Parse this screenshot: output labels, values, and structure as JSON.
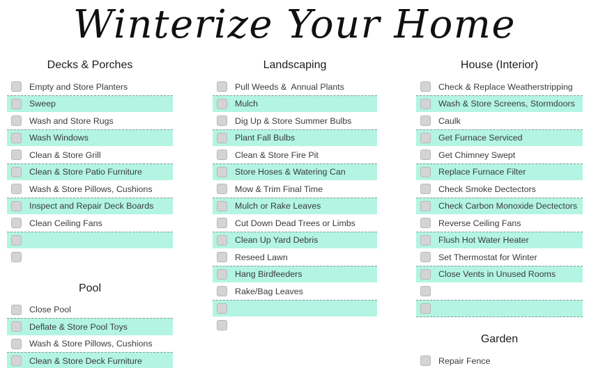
{
  "page": {
    "title": "Winterize Your Home",
    "background_color": "#ffffff",
    "shaded_row_color": "#b3f5e2",
    "checkbox_color": "#d4d4d4",
    "text_color": "#3a3a3a"
  },
  "columns": [
    {
      "id": "column-left",
      "sections": [
        {
          "name": "decks-and-porches",
          "header": "Decks & Porches",
          "items": [
            {
              "label": "Empty and Store Planters",
              "shaded": false
            },
            {
              "label": "Sweep",
              "shaded": true
            },
            {
              "label": "Wash and Store Rugs",
              "shaded": false
            },
            {
              "label": "Wash Windows",
              "shaded": true
            },
            {
              "label": "Clean & Store Grill",
              "shaded": false
            },
            {
              "label": "Clean & Store Patio Furniture",
              "shaded": true
            },
            {
              "label": "Wash & Store Pillows, Cushions",
              "shaded": false
            },
            {
              "label": "Inspect and Repair Deck Boards",
              "shaded": true
            },
            {
              "label": "Clean Ceiling Fans",
              "shaded": false
            },
            {
              "label": "",
              "shaded": true
            },
            {
              "label": "",
              "shaded": false
            }
          ]
        },
        {
          "name": "pool",
          "header": "Pool",
          "items": [
            {
              "label": "Close Pool",
              "shaded": false
            },
            {
              "label": "Deflate & Store Pool Toys",
              "shaded": true
            },
            {
              "label": "Wash & Store Pillows, Cushions",
              "shaded": false
            },
            {
              "label": "Clean & Store Deck Furniture",
              "shaded": true
            }
          ]
        }
      ]
    },
    {
      "id": "column-center",
      "sections": [
        {
          "name": "landscaping",
          "header": "Landscaping",
          "items": [
            {
              "label": "Pull Weeds &  Annual Plants",
              "shaded": false
            },
            {
              "label": "Mulch",
              "shaded": true
            },
            {
              "label": "Dig Up & Store Summer Bulbs",
              "shaded": false
            },
            {
              "label": "Plant Fall Bulbs",
              "shaded": true
            },
            {
              "label": "Clean & Store Fire Pit",
              "shaded": false
            },
            {
              "label": "Store Hoses & Watering Can",
              "shaded": true
            },
            {
              "label": "Mow & Trim Final Time",
              "shaded": false
            },
            {
              "label": "Mulch or Rake Leaves",
              "shaded": true
            },
            {
              "label": "Cut Down Dead Trees or Limbs",
              "shaded": false
            },
            {
              "label": "Clean Up Yard Debris",
              "shaded": true
            },
            {
              "label": "Reseed Lawn",
              "shaded": false
            },
            {
              "label": "Hang Birdfeeders",
              "shaded": true
            },
            {
              "label": "Rake/Bag Leaves",
              "shaded": false
            },
            {
              "label": "",
              "shaded": true
            },
            {
              "label": "",
              "shaded": false
            }
          ]
        }
      ]
    },
    {
      "id": "column-right",
      "sections": [
        {
          "name": "house-interior",
          "header": "House (Interior)",
          "items": [
            {
              "label": "Check & Replace Weatherstripping",
              "shaded": false
            },
            {
              "label": "Wash & Store Screens, Stormdoors",
              "shaded": true
            },
            {
              "label": "Caulk",
              "shaded": false
            },
            {
              "label": "Get Furnace Serviced",
              "shaded": true
            },
            {
              "label": "Get Chimney Swept",
              "shaded": false
            },
            {
              "label": "Replace Furnace Filter",
              "shaded": true
            },
            {
              "label": "Check Smoke Dectectors",
              "shaded": false
            },
            {
              "label": "Check Carbon Monoxide Dectectors",
              "shaded": true
            },
            {
              "label": "Reverse Ceiling Fans",
              "shaded": false
            },
            {
              "label": "Flush Hot Water Heater",
              "shaded": true
            },
            {
              "label": "Set Thermostat for Winter",
              "shaded": false
            },
            {
              "label": "Close Vents in Unused Rooms",
              "shaded": true
            },
            {
              "label": "",
              "shaded": false
            },
            {
              "label": "",
              "shaded": true
            }
          ]
        },
        {
          "name": "garden",
          "header": "Garden",
          "items": [
            {
              "label": "Repair Fence",
              "shaded": false
            }
          ]
        }
      ]
    }
  ]
}
